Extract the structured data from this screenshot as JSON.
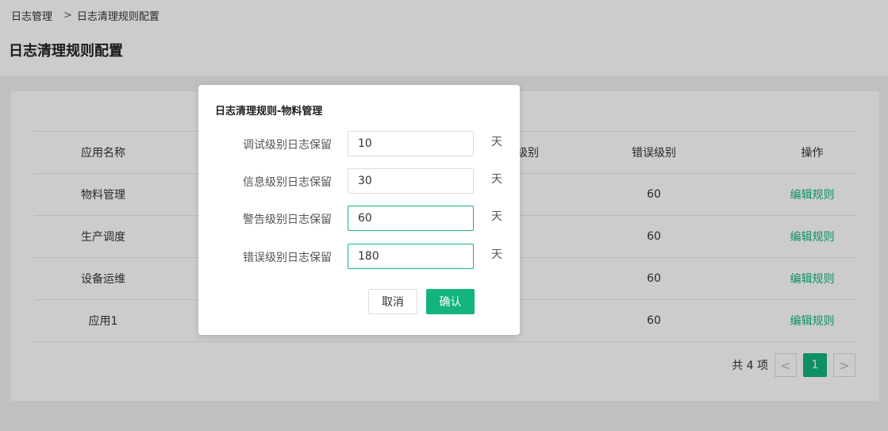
{
  "breadcrumb": {
    "root": "日志管理",
    "sep": ">",
    "current": "日志清理规则配置"
  },
  "page": {
    "title": "日志清理规则配置"
  },
  "table": {
    "headers": {
      "name": "应用名称",
      "warn": "级别",
      "error": "错误级别",
      "op": "操作"
    },
    "rows": [
      {
        "name": "物料管理",
        "error": "60",
        "op": "编辑规则"
      },
      {
        "name": "生产调度",
        "error": "60",
        "op": "编辑规则"
      },
      {
        "name": "设备运维",
        "error": "60",
        "op": "编辑规则"
      },
      {
        "name": "应用1",
        "error": "60",
        "op": "编辑规则"
      }
    ]
  },
  "pagination": {
    "total": "共 4 项",
    "page": "1",
    "prev": "<",
    "next": ">"
  },
  "dialog": {
    "title": "日志清理规则-物料管理",
    "fields": [
      {
        "label": "调试级别日志保留",
        "value": "10",
        "unit": "天"
      },
      {
        "label": "信息级别日志保留",
        "value": "30",
        "unit": "天"
      },
      {
        "label": "警告级别日志保留",
        "value": "60",
        "unit": "天"
      },
      {
        "label": "错误级别日志保留",
        "value": "180",
        "unit": "天"
      }
    ],
    "cancel_label": "取消",
    "confirm_label": "确认"
  },
  "colors": {
    "accent": "#13b57c",
    "mask": "rgba(0,0,0,0.2)"
  }
}
